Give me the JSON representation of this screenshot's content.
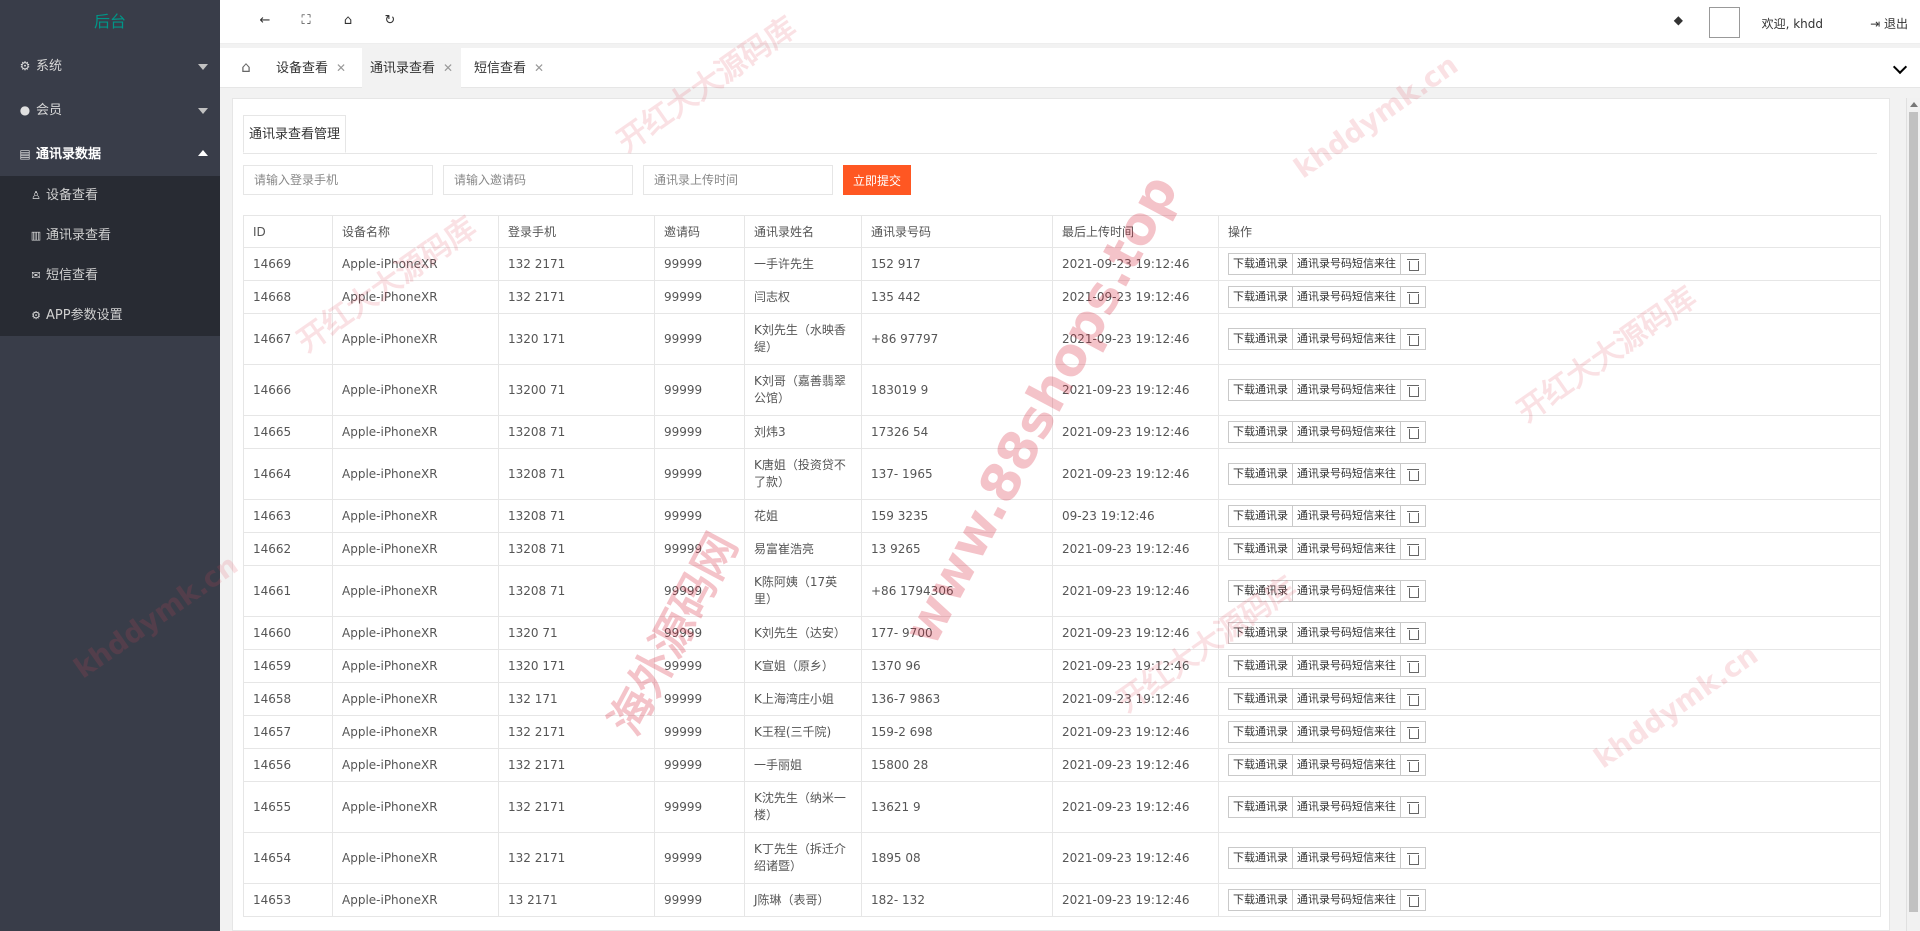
{
  "sidebar": {
    "logo": "后台",
    "items": [
      {
        "label": "系统",
        "icon": "gear-icon"
      },
      {
        "label": "会员",
        "icon": "users-icon"
      },
      {
        "label": "通讯录数据",
        "icon": "id-card-icon"
      }
    ],
    "subitems": [
      {
        "label": "设备查看",
        "icon": "user-icon"
      },
      {
        "label": "通讯录查看",
        "icon": "book-icon"
      },
      {
        "label": "短信查看",
        "icon": "envelope-icon"
      },
      {
        "label": "APP参数设置",
        "icon": "gear-icon"
      }
    ]
  },
  "header": {
    "welcome": "欢迎, khdd",
    "logout": "退出"
  },
  "tabs": [
    {
      "label": "设备查看"
    },
    {
      "label": "通讯录查看"
    },
    {
      "label": "短信查看"
    }
  ],
  "panel": {
    "title": "通讯录查看管理",
    "search": {
      "phone_placeholder": "请输入登录手机",
      "invite_placeholder": "请输入邀请码",
      "time_placeholder": "通讯录上传时间",
      "submit": "立即提交"
    },
    "columns": [
      "ID",
      "设备名称",
      "登录手机",
      "邀请码",
      "通讯录姓名",
      "通讯录号码",
      "最后上传时间",
      "操作"
    ],
    "actions": {
      "download": "下载通讯录",
      "sms": "通讯录号码短信来往"
    },
    "rows": [
      {
        "id": "14669",
        "device": "Apple-iPhoneXR",
        "phone": "132 2171",
        "code": "99999",
        "name": "一手许先生",
        "number": "152 917",
        "time": "2021-09-23 19:12:46",
        "tall": false
      },
      {
        "id": "14668",
        "device": "Apple-iPhoneXR",
        "phone": "132 2171",
        "code": "99999",
        "name": "闫志权",
        "number": "135 442",
        "time": "2021-09-23 19:12:46",
        "tall": false
      },
      {
        "id": "14667",
        "device": "Apple-iPhoneXR",
        "phone": "1320 171",
        "code": "99999",
        "name": "K刘先生（水映香缇）",
        "number": "+86 97797",
        "time": "2021-09-23 19:12:46",
        "tall": true
      },
      {
        "id": "14666",
        "device": "Apple-iPhoneXR",
        "phone": "13200 71",
        "code": "99999",
        "name": "K刘哥（嘉善翡翠公馆）",
        "number": "183019 9",
        "time": "2021-09-23 19:12:46",
        "tall": true
      },
      {
        "id": "14665",
        "device": "Apple-iPhoneXR",
        "phone": "13208 71",
        "code": "99999",
        "name": "刘炜3",
        "number": "17326 54",
        "time": "2021-09-23 19:12:46",
        "tall": false
      },
      {
        "id": "14664",
        "device": "Apple-iPhoneXR",
        "phone": "13208 71",
        "code": "99999",
        "name": "K唐姐（投资贷不了款）",
        "number": "137- 1965",
        "time": "2021-09-23 19:12:46",
        "tall": true
      },
      {
        "id": "14663",
        "device": "Apple-iPhoneXR",
        "phone": "13208 71",
        "code": "99999",
        "name": "花姐",
        "number": "159 3235",
        "time": "09-23 19:12:46",
        "tall": false
      },
      {
        "id": "14662",
        "device": "Apple-iPhoneXR",
        "phone": "13208 71",
        "code": "99999",
        "name": "易富崔浩亮",
        "number": "13 9265",
        "time": "2021-09-23 19:12:46",
        "tall": false
      },
      {
        "id": "14661",
        "device": "Apple-iPhoneXR",
        "phone": "13208 71",
        "code": "99999",
        "name": "K陈阿姨（17英里）",
        "number": "+86 1794306",
        "time": "2021-09-23 19:12:46",
        "tall": true
      },
      {
        "id": "14660",
        "device": "Apple-iPhoneXR",
        "phone": "1320 71",
        "code": "99999",
        "name": "K刘先生（达安）",
        "number": "177- 9700",
        "time": "2021-09-23 19:12:46",
        "tall": false
      },
      {
        "id": "14659",
        "device": "Apple-iPhoneXR",
        "phone": "1320 171",
        "code": "99999",
        "name": "K宣姐（原乡）",
        "number": "1370 96",
        "time": "2021-09-23 19:12:46",
        "tall": false
      },
      {
        "id": "14658",
        "device": "Apple-iPhoneXR",
        "phone": "132 171",
        "code": "99999",
        "name": "K上海湾庄小姐",
        "number": "136-7 9863",
        "time": "2021-09-23 19:12:46",
        "tall": false
      },
      {
        "id": "14657",
        "device": "Apple-iPhoneXR",
        "phone": "132 2171",
        "code": "99999",
        "name": "K王程(三千院)",
        "number": "159-2 698",
        "time": "2021-09-23 19:12:46",
        "tall": false
      },
      {
        "id": "14656",
        "device": "Apple-iPhoneXR",
        "phone": "132 2171",
        "code": "99999",
        "name": "一手丽姐",
        "number": "15800 28",
        "time": "2021-09-23 19:12:46",
        "tall": false
      },
      {
        "id": "14655",
        "device": "Apple-iPhoneXR",
        "phone": "132 2171",
        "code": "99999",
        "name": "K沈先生（纳米一楼）",
        "number": "13621 9",
        "time": "2021-09-23 19:12:46",
        "tall": true
      },
      {
        "id": "14654",
        "device": "Apple-iPhoneXR",
        "phone": "132 2171",
        "code": "99999",
        "name": "K丁先生（拆迁介绍诸暨）",
        "number": "1895 08",
        "time": "2021-09-23 19:12:46",
        "tall": true
      },
      {
        "id": "14653",
        "device": "Apple-iPhoneXR",
        "phone": "13 2171",
        "code": "99999",
        "name": "J陈琳（表哥）",
        "number": "182- 132",
        "time": "2021-09-23 19:12:46",
        "tall": false
      }
    ]
  },
  "watermark": {
    "text1": "开红大大源码库",
    "text2": "khddymk.cn",
    "url": "www.88shops.top",
    "overseas": "海外源码网"
  },
  "colors": {
    "sidebar_bg": "#393d49",
    "sidebar_sub_bg": "#282b33",
    "logo": "#009688",
    "submit": "#ff5722"
  }
}
